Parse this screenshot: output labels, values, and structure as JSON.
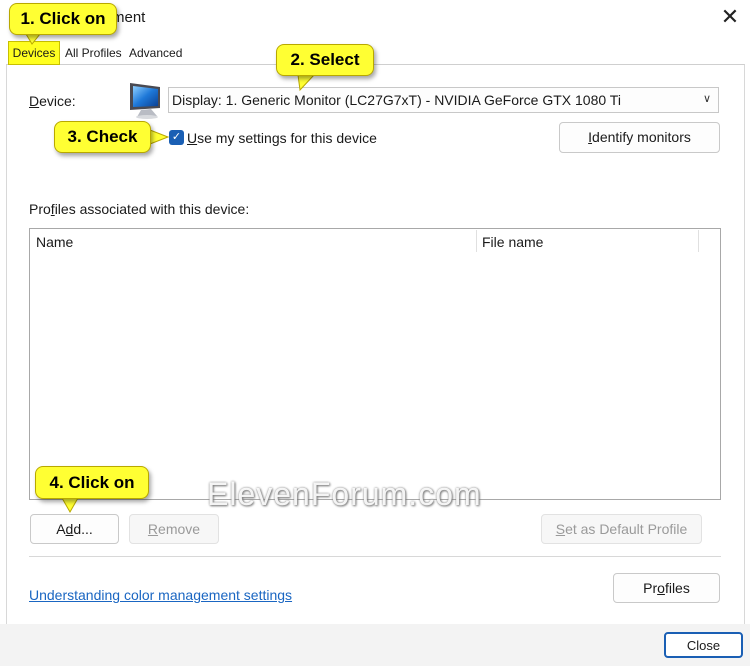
{
  "window": {
    "title_visible": "ment",
    "close_glyph": "✕"
  },
  "tabs": [
    {
      "label": "Devices",
      "selected": true
    },
    {
      "label": "All Profiles",
      "selected": false
    },
    {
      "label": "Advanced",
      "selected": false
    }
  ],
  "device": {
    "label_underlined_char": "D",
    "label_rest": "evice:",
    "selected_value": "Display: 1. Generic Monitor (LC27G7xT) - NVIDIA GeForce GTX 1080 Ti",
    "icon": "monitor-icon"
  },
  "checkbox": {
    "checked": true,
    "label_underlined_char": "U",
    "label_rest": "se my settings for this device"
  },
  "identify_button": {
    "underlined_char": "I",
    "rest": "dentify monitors"
  },
  "profiles_section": {
    "label_pre": "Pro",
    "label_underlined_char": "f",
    "label_rest": "iles associated with this device:",
    "columns": [
      "Name",
      "File name"
    ],
    "rows": []
  },
  "buttons": {
    "add_pre": "A",
    "add_underlined_char": "d",
    "add_rest": "d...",
    "remove_underlined_char": "R",
    "remove_rest": "emove",
    "default_underlined_char": "S",
    "default_rest": "et as Default Profile",
    "profiles_pre": "Pr",
    "profiles_underlined_char": "o",
    "profiles_rest": "files",
    "close": "Close"
  },
  "link": "Understanding color management settings",
  "callouts": {
    "c1": "1. Click on",
    "c2": "2. Select",
    "c3": "3. Check",
    "c4": "4. Click on"
  },
  "watermark": "ElevenForum.com",
  "colors": {
    "callout": "#ffff33",
    "accent": "#1a5fb4",
    "link": "#1a66c2"
  }
}
